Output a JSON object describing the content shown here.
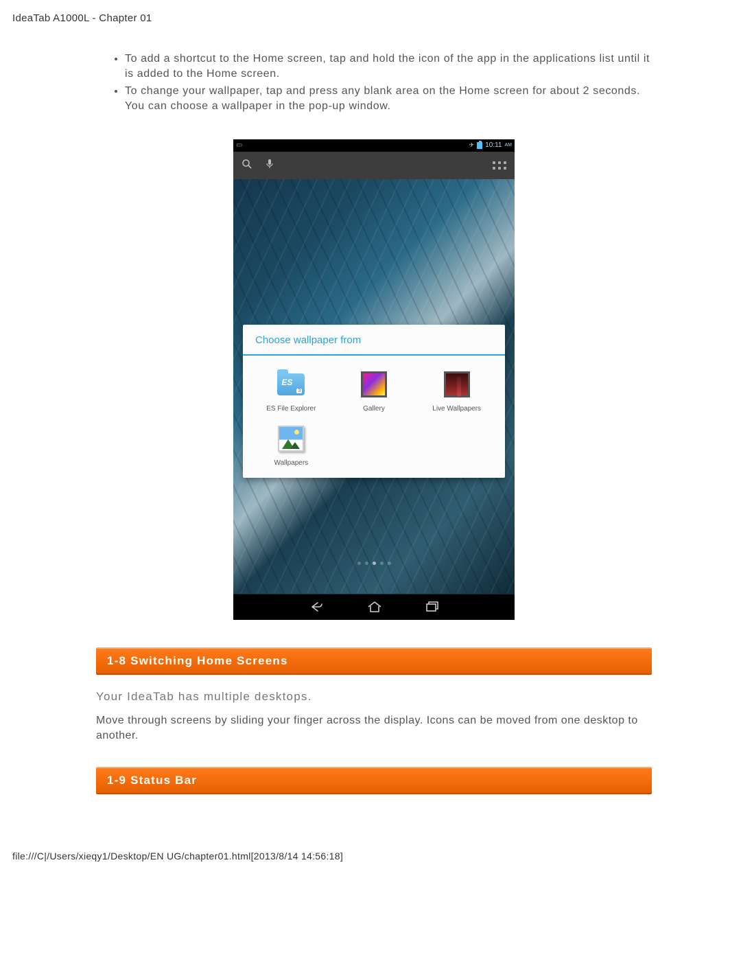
{
  "header": "IdeaTab A1000L - Chapter 01",
  "bullets": [
    "To add a shortcut to the Home screen, tap and hold the icon of the app in the applications list until it is added to the Home screen.",
    "To change your wallpaper, tap and press any blank area on the Home screen for about 2 seconds. You can choose a wallpaper in the pop-up window."
  ],
  "tablet": {
    "status": {
      "left_icon": "▭",
      "plane": "✈",
      "time": "10:11",
      "ampm": "AM"
    },
    "dialog": {
      "title": "Choose wallpaper from",
      "items": [
        {
          "label": "ES File Explorer"
        },
        {
          "label": "Gallery"
        },
        {
          "label": "Live Wallpapers"
        },
        {
          "label": "Wallpapers"
        }
      ]
    }
  },
  "sections": [
    {
      "heading": "1-8 Switching Home Screens",
      "intro": "Your IdeaTab has multiple desktops.",
      "para": "Move through screens by sliding your finger across the display. Icons can be moved from one desktop to another."
    },
    {
      "heading": "1-9 Status Bar"
    }
  ],
  "footer": "file:///C|/Users/xieqy1/Desktop/EN UG/chapter01.html[2013/8/14 14:56:18]"
}
